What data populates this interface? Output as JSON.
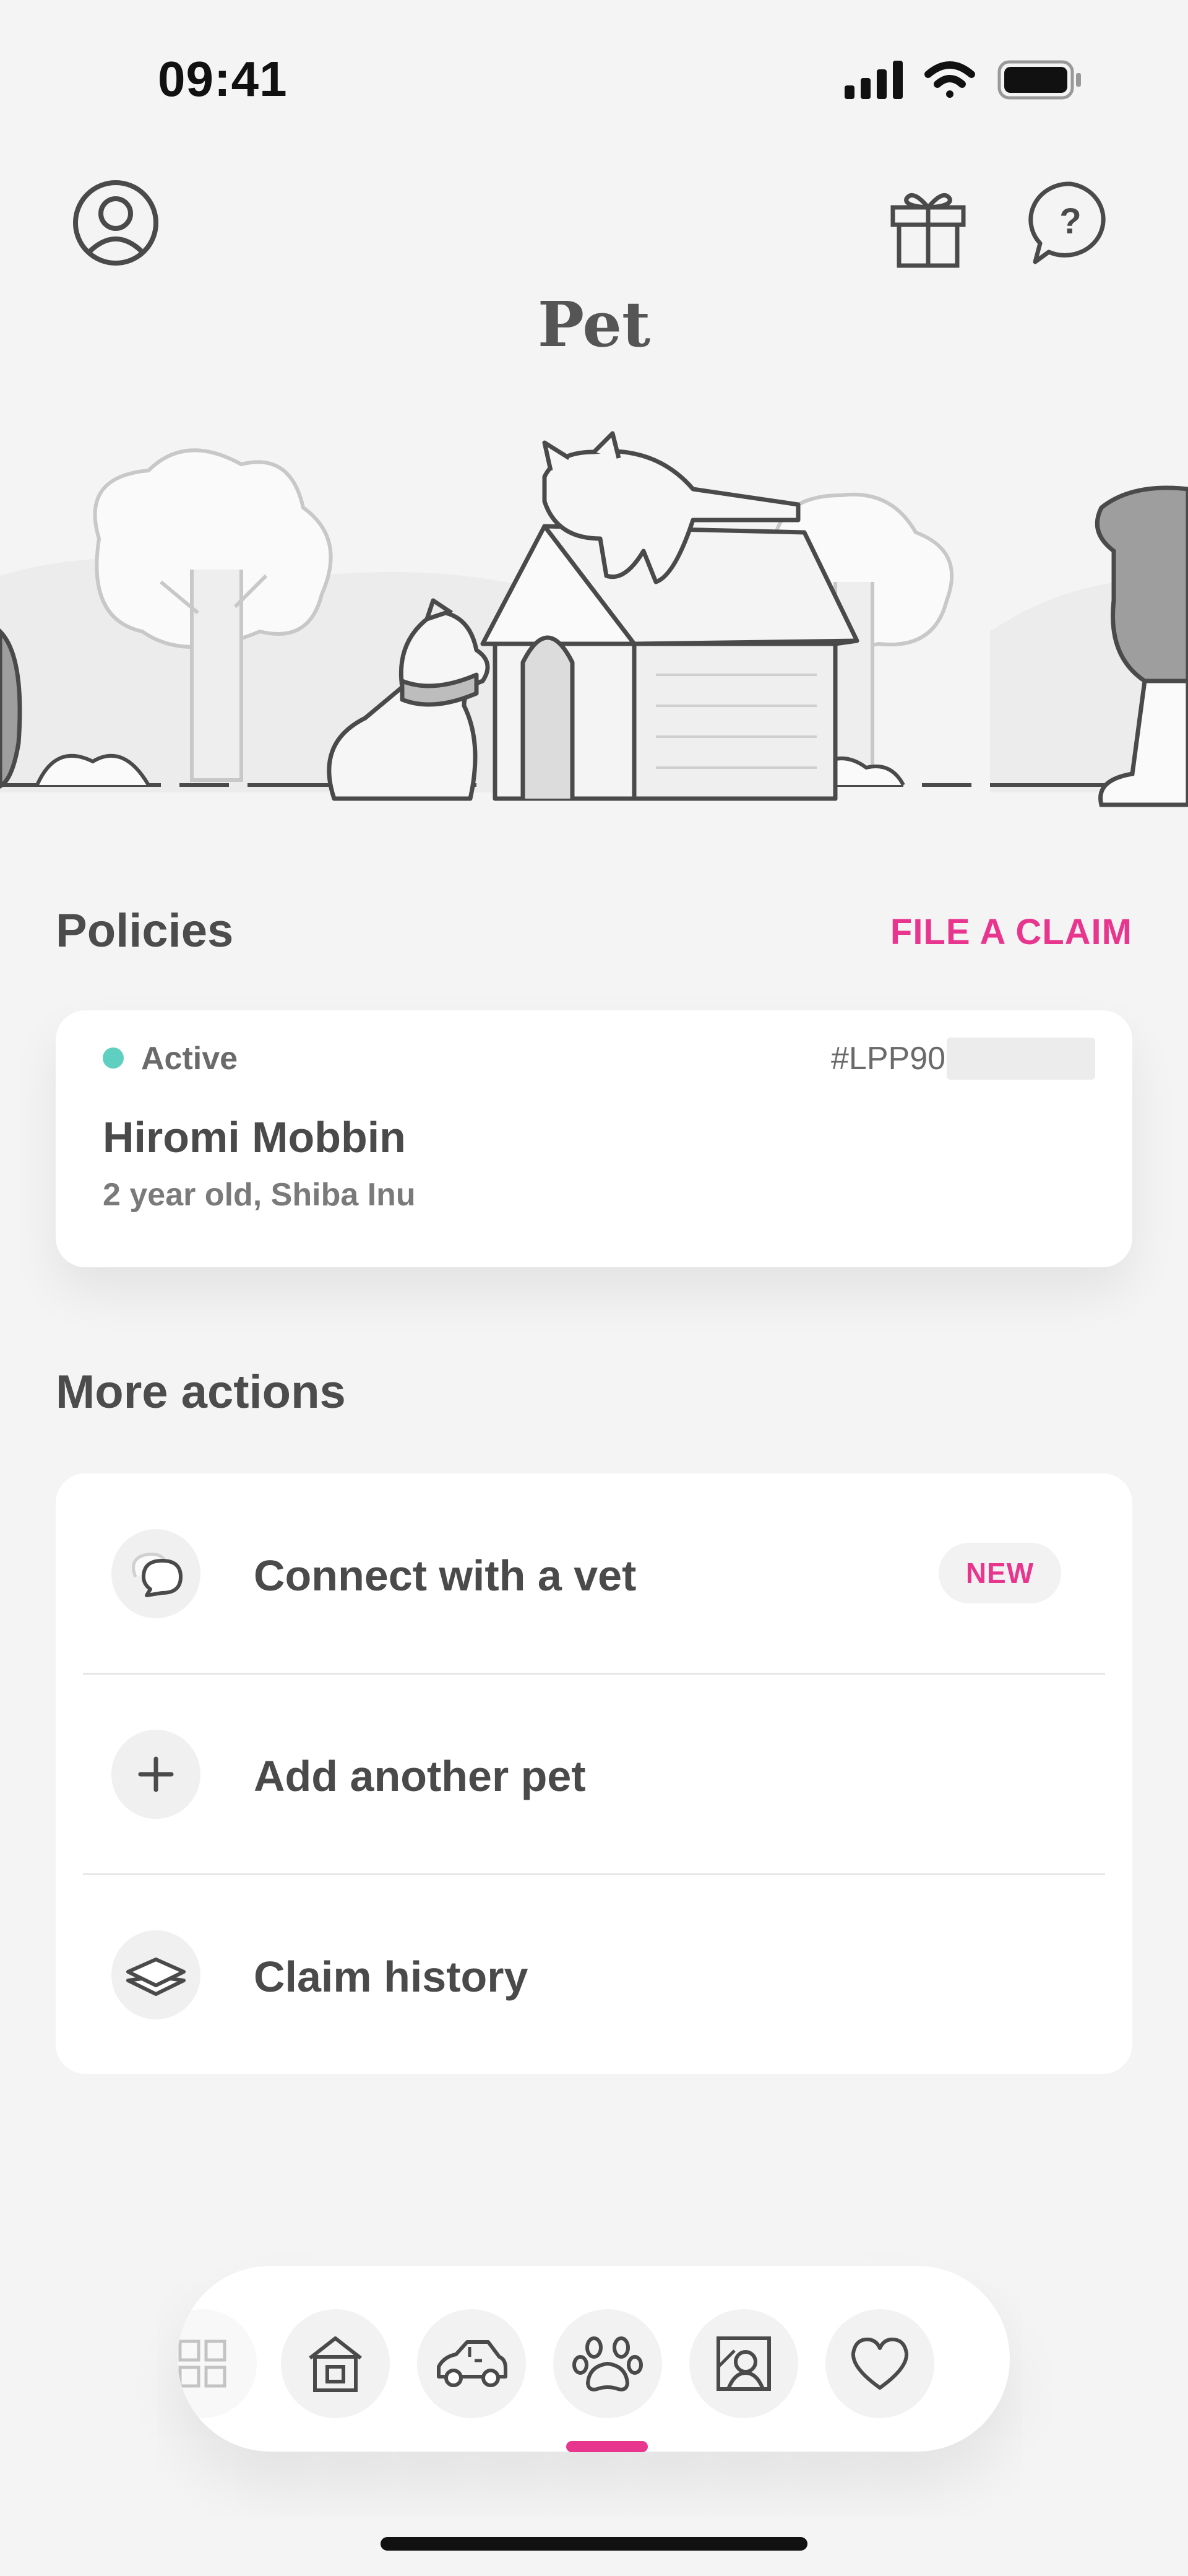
{
  "status_bar": {
    "time": "09:41"
  },
  "header": {
    "title": "Pet"
  },
  "policies": {
    "section_title": "Policies",
    "file_claim_label": "FILE A CLAIM",
    "card": {
      "status": "Active",
      "status_color": "#5ecfc0",
      "policy_number": "#LPP90",
      "pet_name": "Hiromi Mobbin",
      "pet_description": "2 year old, Shiba Inu"
    }
  },
  "more_actions": {
    "section_title": "More actions",
    "items": [
      {
        "label": "Connect with a vet",
        "icon": "chat-bubbles-icon",
        "badge": "NEW"
      },
      {
        "label": "Add another pet",
        "icon": "plus-icon"
      },
      {
        "label": "Claim history",
        "icon": "layers-icon"
      }
    ]
  },
  "bottom_nav": {
    "items": [
      {
        "icon": "grid-icon"
      },
      {
        "icon": "home-icon"
      },
      {
        "icon": "car-icon"
      },
      {
        "icon": "paw-icon",
        "active": true
      },
      {
        "icon": "portrait-icon"
      },
      {
        "icon": "heart-icon"
      }
    ]
  },
  "colors": {
    "accent": "#e8368f",
    "background": "#f4f4f4",
    "active_dot": "#5ecfc0"
  }
}
